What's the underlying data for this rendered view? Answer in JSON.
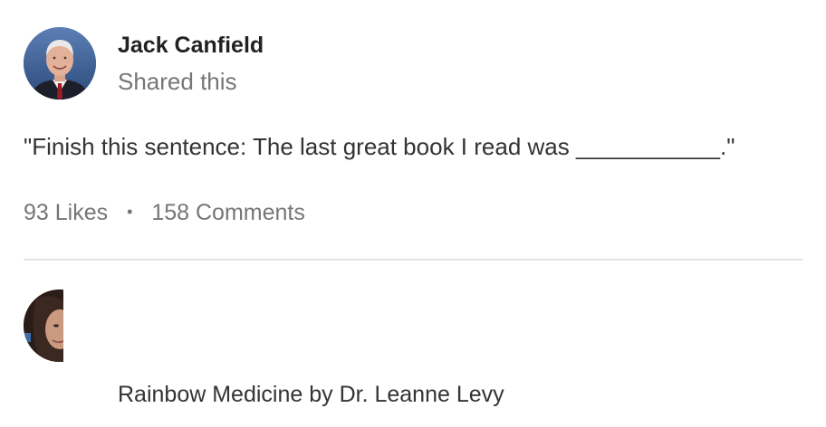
{
  "post": {
    "author": {
      "name": "Jack Canfield",
      "action": "Shared this",
      "avatar_icon": "person-photo"
    },
    "text": "\"Finish this sentence: The last great book I read was ___________.\"",
    "stats": {
      "likes": "93 Likes",
      "separator": "•",
      "comments": "158 Comments"
    }
  },
  "comment": {
    "author": "Rainbow Medicine by Dr. Leanne Levy",
    "avatar_icon": "person-photo"
  },
  "colors": {
    "primary_text": "#333333",
    "secondary_text": "#767676",
    "divider": "#e3e3e3"
  }
}
